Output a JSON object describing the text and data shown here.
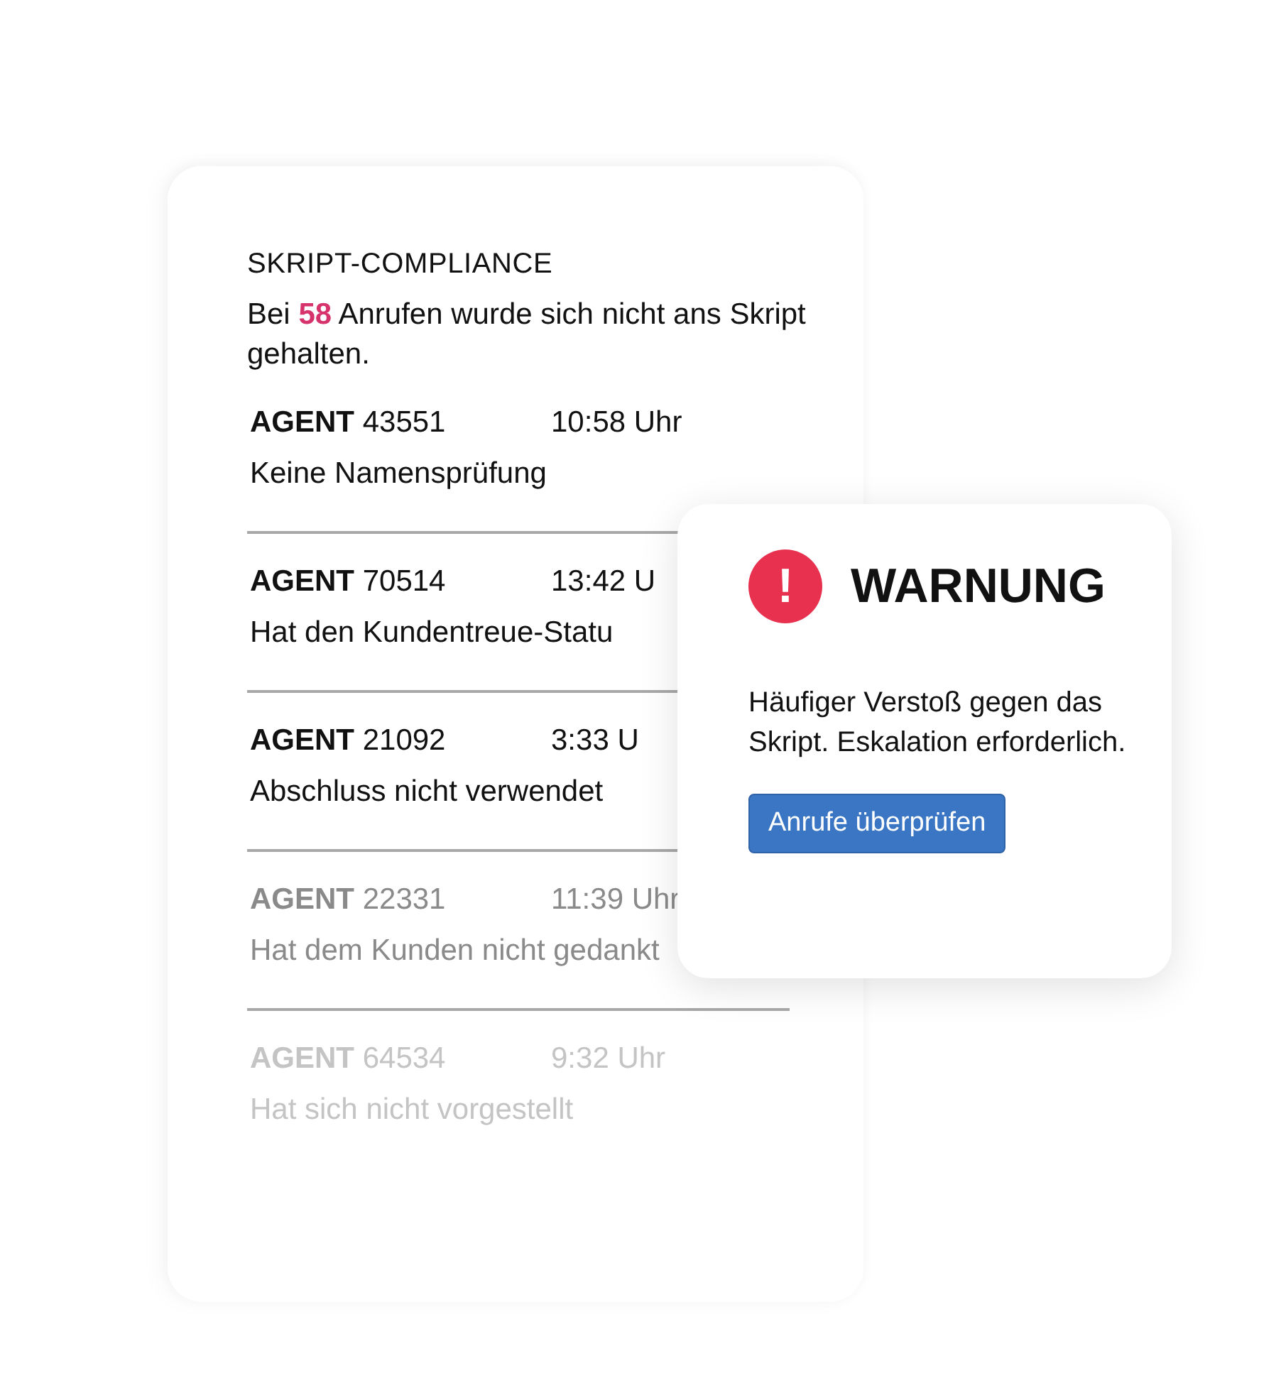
{
  "card": {
    "title": "SKRIPT-COMPLIANCE",
    "summary": "Bei **58** Anrufen wurde sich nicht ans Skript gehalten.",
    "rows": [
      {
        "kind": "regular",
        "agent_label": "AGENT",
        "agent_id": "43551",
        "time": "10:58 Uhr",
        "issue": "Keine Namensprüfung"
      },
      {
        "kind": "regular",
        "agent_label": "AGENT",
        "agent_id": "70514",
        "time": "13:42 U",
        "issue": "Hat den Kundentreue-Statu"
      },
      {
        "kind": "regular",
        "agent_label": "AGENT",
        "agent_id": "21092",
        "time": "3:33 U",
        "issue": "Abschluss nicht verwendet"
      },
      {
        "kind": "muted",
        "agent_label": "AGENT",
        "agent_id": "22331",
        "time": "11:39 Uhr",
        "issue": "Hat dem Kunden nicht gedankt"
      },
      {
        "kind": "faint",
        "agent_label": "AGENT",
        "agent_id": "64534",
        "time": "9:32 Uhr",
        "issue": "Hat sich nicht vorgestellt"
      }
    ]
  },
  "alert": {
    "icon_glyph": "!",
    "title": "WARNUNG",
    "message": "Häufiger Verstoß gegen das Skript. Eskalation erforderlich.",
    "button": "Anrufe überprüfen"
  }
}
